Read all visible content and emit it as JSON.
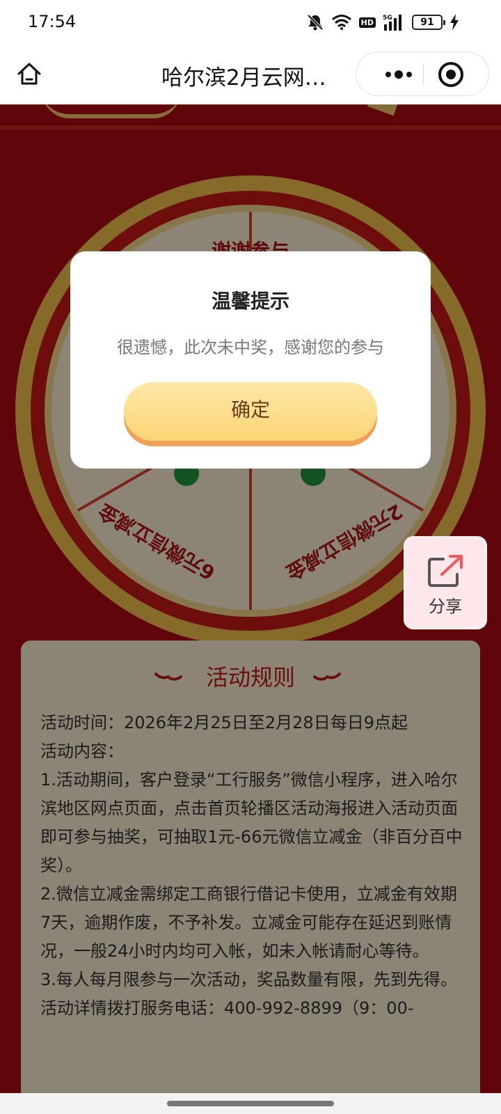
{
  "status_bar": {
    "time": "17:54",
    "battery": "91",
    "network": "5G",
    "hd": "HD",
    "icons": [
      "mute-icon",
      "wifi-icon",
      "hd-icon",
      "signal-icon",
      "battery-icon",
      "charging-icon"
    ]
  },
  "navbar": {
    "title": "哈尔滨2月云网…",
    "home_icon": "home-icon",
    "more_icon": "more-icon",
    "close_icon": "close-miniprogram-icon"
  },
  "wheel": {
    "segments": [
      "谢谢参与",
      "6元微信立减金",
      "2元微信立减金"
    ]
  },
  "share": {
    "label": "分享",
    "icon": "share-icon"
  },
  "rules": {
    "title": "活动规则",
    "lines": [
      "活动时间：2026年2月25日至2月28日每日9点起",
      "活动内容：",
      "1.活动期间，客户登录“工行服务”微信小程序，进入哈尔滨地区网点页面，点击首页轮播区活动海报进入活动页面即可参与抽奖，可抽取1元-66元微信立减金（非百分百中奖）。",
      "2.微信立减金需绑定工商银行借记卡使用，立减金有效期7天，逾期作废，不予补发。立减金可能存在延迟到账情况，一般24小时内均可入帐，如未入帐请耐心等待。",
      "3.每人每月限参与一次活动，奖品数量有限，先到先得。",
      "活动详情拨打服务电话：400-992-8899（9：00-"
    ]
  },
  "modal": {
    "title": "温馨提示",
    "message": "很遗憾，此次未中奖，感谢您的参与",
    "confirm_label": "确定"
  },
  "colors": {
    "page_red": "#b00b14",
    "wheel_gold": "#f2c14e",
    "segment_cream": "#fff3d6",
    "rules_bg": "#fff1d6",
    "button_gold": "#fbd574",
    "button_shadow": "#f0a057"
  }
}
